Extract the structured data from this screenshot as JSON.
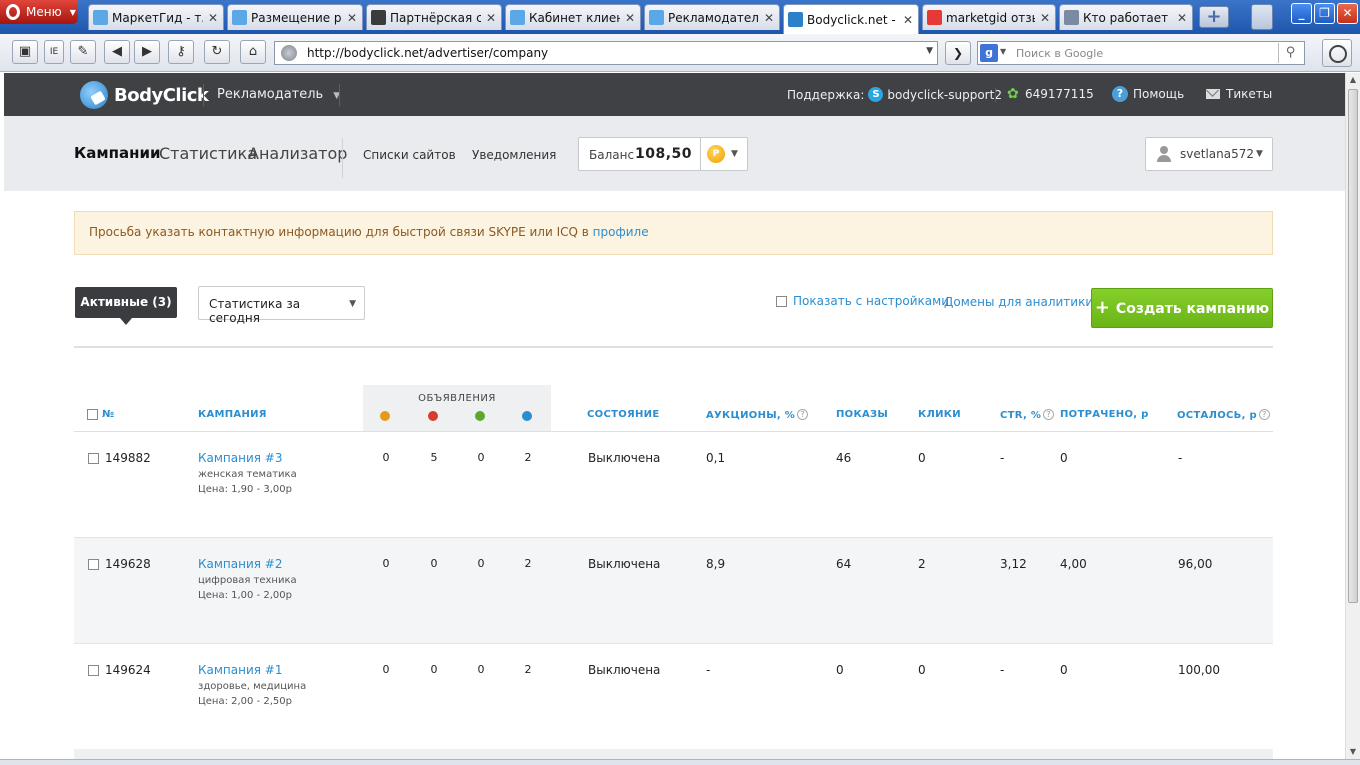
{
  "browser": {
    "menu_label": "Меню",
    "tabs": [
      {
        "title": "МаркетГид - т...",
        "fav": "#5aa9e6"
      },
      {
        "title": "Размещение ре...",
        "fav": "#5aa9e6"
      },
      {
        "title": "Партнёрская с...",
        "fav": "#3b3b3b"
      },
      {
        "title": "Кабинет клиента",
        "fav": "#5aa9e6"
      },
      {
        "title": "Рекламодател...",
        "fav": "#5aa9e6"
      },
      {
        "title": "Bodyclick.net - ...",
        "fav": "#2c7fc9"
      },
      {
        "title": "marketgid отзы...",
        "fav": "#e53935"
      },
      {
        "title": "Кто работает ...",
        "fav": "#7a8aa0"
      }
    ],
    "url": "http://bodyclick.net/advertiser/company",
    "search_placeholder": "Поиск в Google"
  },
  "site": {
    "logo": "BodyClick",
    "role": "Рекламодатель",
    "support_label": "Поддержка:",
    "support_skype": "bodyclick-support2",
    "icq": "649177115",
    "help": "Помощь",
    "tickets": "Тикеты"
  },
  "nav": {
    "campaigns": "Кампании",
    "stats": "Статистика",
    "analyzer": "Анализатор",
    "site_lists": "Списки сайтов",
    "notifications": "Уведомления",
    "balance_label": "Баланс",
    "balance_value": "108,50",
    "currency": "Р",
    "username": "svetlana572"
  },
  "notice": {
    "text": "Просьба указать контактную информацию для быстрой связи SKYPE или ICQ в",
    "link": "профиле"
  },
  "controls": {
    "active": "Активные (3)",
    "period": "Статистика за сегодня",
    "show_settings": "Показать с настройками",
    "domains": "Домены для аналитики",
    "create": "Создать кампанию"
  },
  "table": {
    "headers": {
      "num": "№",
      "campaign": "КАМПАНИЯ",
      "ads": "ОБЪЯВЛЕНИЯ",
      "status": "СОСТОЯНИЕ",
      "auctions": "АУКЦИОНЫ, %",
      "shows": "ПОКАЗЫ",
      "clicks": "КЛИКИ",
      "ctr": "CTR, %",
      "spent": "ПОТРАЧЕНО, р",
      "left": "ОСТАЛОСЬ, р"
    },
    "ad_status_colors": [
      "#e69a1a",
      "#d63b2b",
      "#5aaa2a",
      "#2b8ed0"
    ],
    "rows": [
      {
        "id": "149882",
        "name": "Кампания #3",
        "topic": "женская тематика",
        "price": "Цена: 1,90 - 3,00р",
        "a1": "0",
        "a2": "5",
        "a3": "0",
        "a4": "2",
        "status": "Выключена",
        "auctions": "0,1",
        "shows": "46",
        "clicks": "0",
        "ctr": "-",
        "spent": "0",
        "left": "-"
      },
      {
        "id": "149628",
        "name": "Кампания #2",
        "topic": "цифровая техника",
        "price": "Цена: 1,00 - 2,00р",
        "a1": "0",
        "a2": "0",
        "a3": "0",
        "a4": "2",
        "status": "Выключена",
        "auctions": "8,9",
        "shows": "64",
        "clicks": "2",
        "ctr": "3,12",
        "spent": "4,00",
        "left": "96,00"
      },
      {
        "id": "149624",
        "name": "Кампания #1",
        "topic": "здоровье, медицина",
        "price": "Цена: 2,00 - 2,50р",
        "a1": "0",
        "a2": "0",
        "a3": "0",
        "a4": "2",
        "status": "Выключена",
        "auctions": "-",
        "shows": "0",
        "clicks": "0",
        "ctr": "-",
        "spent": "0",
        "left": "100,00"
      }
    ]
  }
}
